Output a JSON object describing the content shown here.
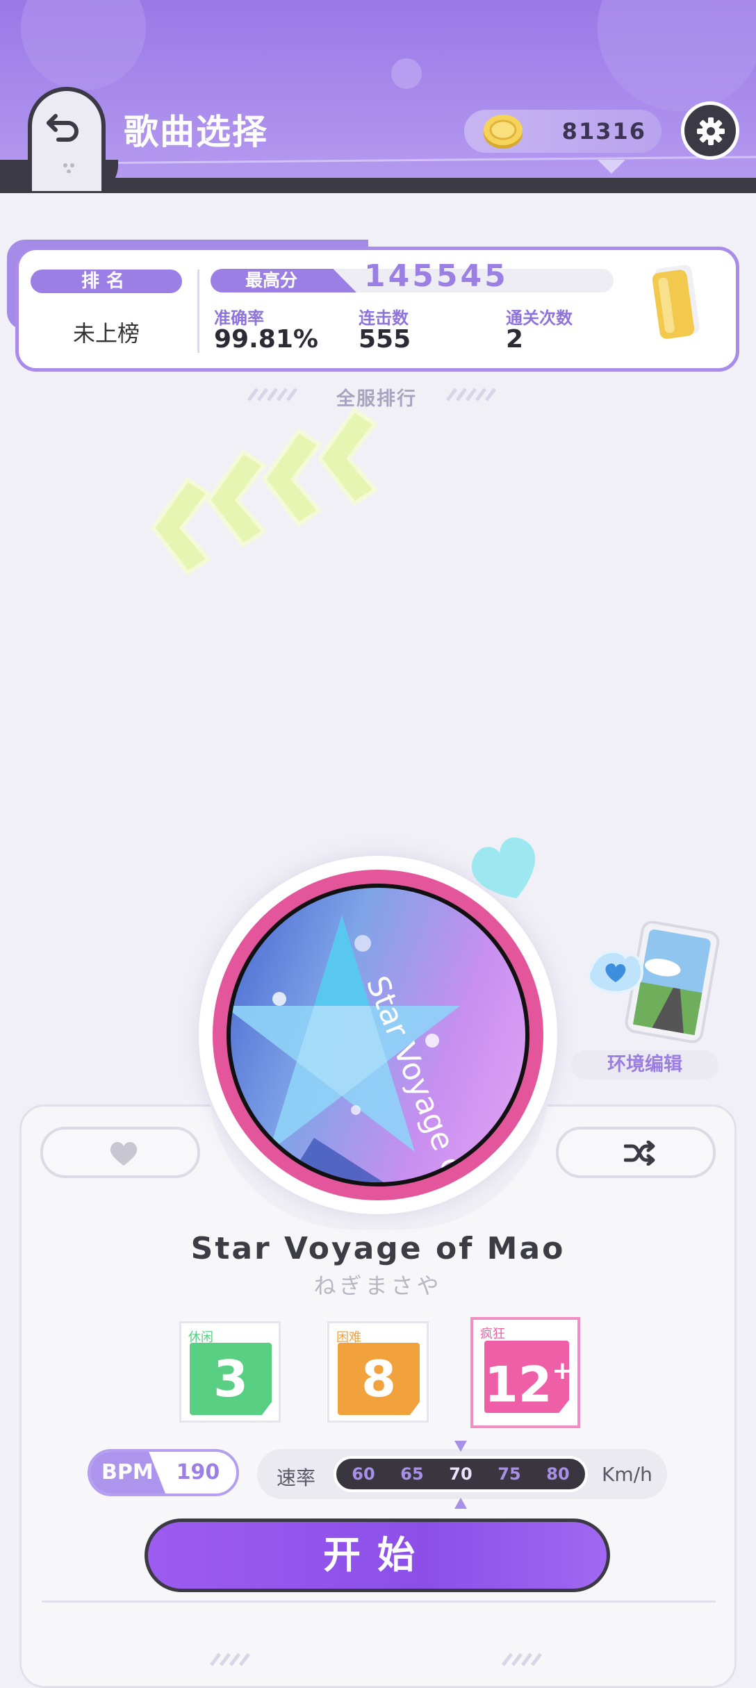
{
  "header": {
    "title": "歌曲选择",
    "coins": "81316"
  },
  "stats": {
    "rank_label": "排名",
    "rank_value": "未上榜",
    "best_label": "最高分",
    "best_value": "145545",
    "accuracy_label": "准确率",
    "accuracy_value": "99.81%",
    "combo_label": "连击数",
    "combo_value": "555",
    "clears_label": "通关次数",
    "clears_value": "2",
    "server_rank": "全服排行"
  },
  "disc": {
    "cover_text": "Star Voyage of Mao"
  },
  "environment": {
    "label": "环境编辑"
  },
  "song": {
    "title": "Star Voyage of Mao",
    "artist": "ねぎまさや"
  },
  "difficulties": [
    {
      "label": "休闲",
      "level": "3",
      "color": "#58cf83",
      "label_color": "#58cf83"
    },
    {
      "label": "困难",
      "level": "8",
      "color": "#f2a23c",
      "label_color": "#f2a23c"
    },
    {
      "label": "疯狂",
      "level": "12",
      "plus": "+",
      "color": "#ee5fa8",
      "label_color": "#ee5fa8",
      "selected": true
    }
  ],
  "bpm": {
    "label": "BPM",
    "value": "190"
  },
  "speed": {
    "label": "速率",
    "options": [
      "60",
      "65",
      "70",
      "75",
      "80"
    ],
    "selected": "70",
    "unit": "Km/h"
  },
  "start_button": "开始",
  "colors": {
    "accent": "#9b7fe5",
    "header": "#a98bec",
    "start": "#8b4fe8",
    "disc_ring": "#e4569c"
  }
}
